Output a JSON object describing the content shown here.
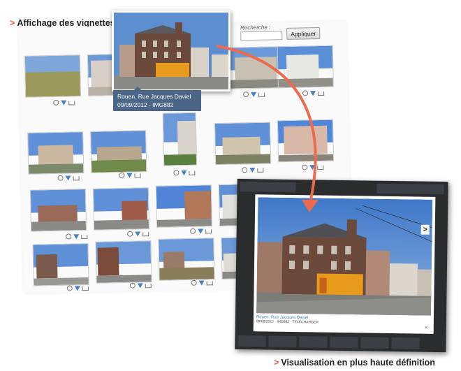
{
  "captions": {
    "top": "Affichage des vignettes",
    "bottom": "Visualisation en plus haute définition",
    "marker": ">"
  },
  "search": {
    "label": "Recherche :",
    "placeholder": "",
    "button": "Appliquer"
  },
  "popup": {
    "title": "Rouen. Rue Jacques Daviel",
    "meta": "09/09/2012 - IMG882"
  },
  "lightbox": {
    "title": "Rouen. Rue Jacques Daviel",
    "meta": "09/09/2012 · IMG882 · TELECHARGER",
    "next": ">",
    "close": "×"
  },
  "colors": {
    "accent": "#e8553a",
    "tooltip": "#4b6587",
    "lightbox_bg": "#2a2c2e",
    "sky": "#5d8fd0",
    "brick": "#6b4a3c",
    "storefront": "#e79a1c"
  },
  "icons": [
    "zoom-icon",
    "download-icon",
    "cart-icon",
    "chevron-right-icon",
    "close-icon"
  ]
}
